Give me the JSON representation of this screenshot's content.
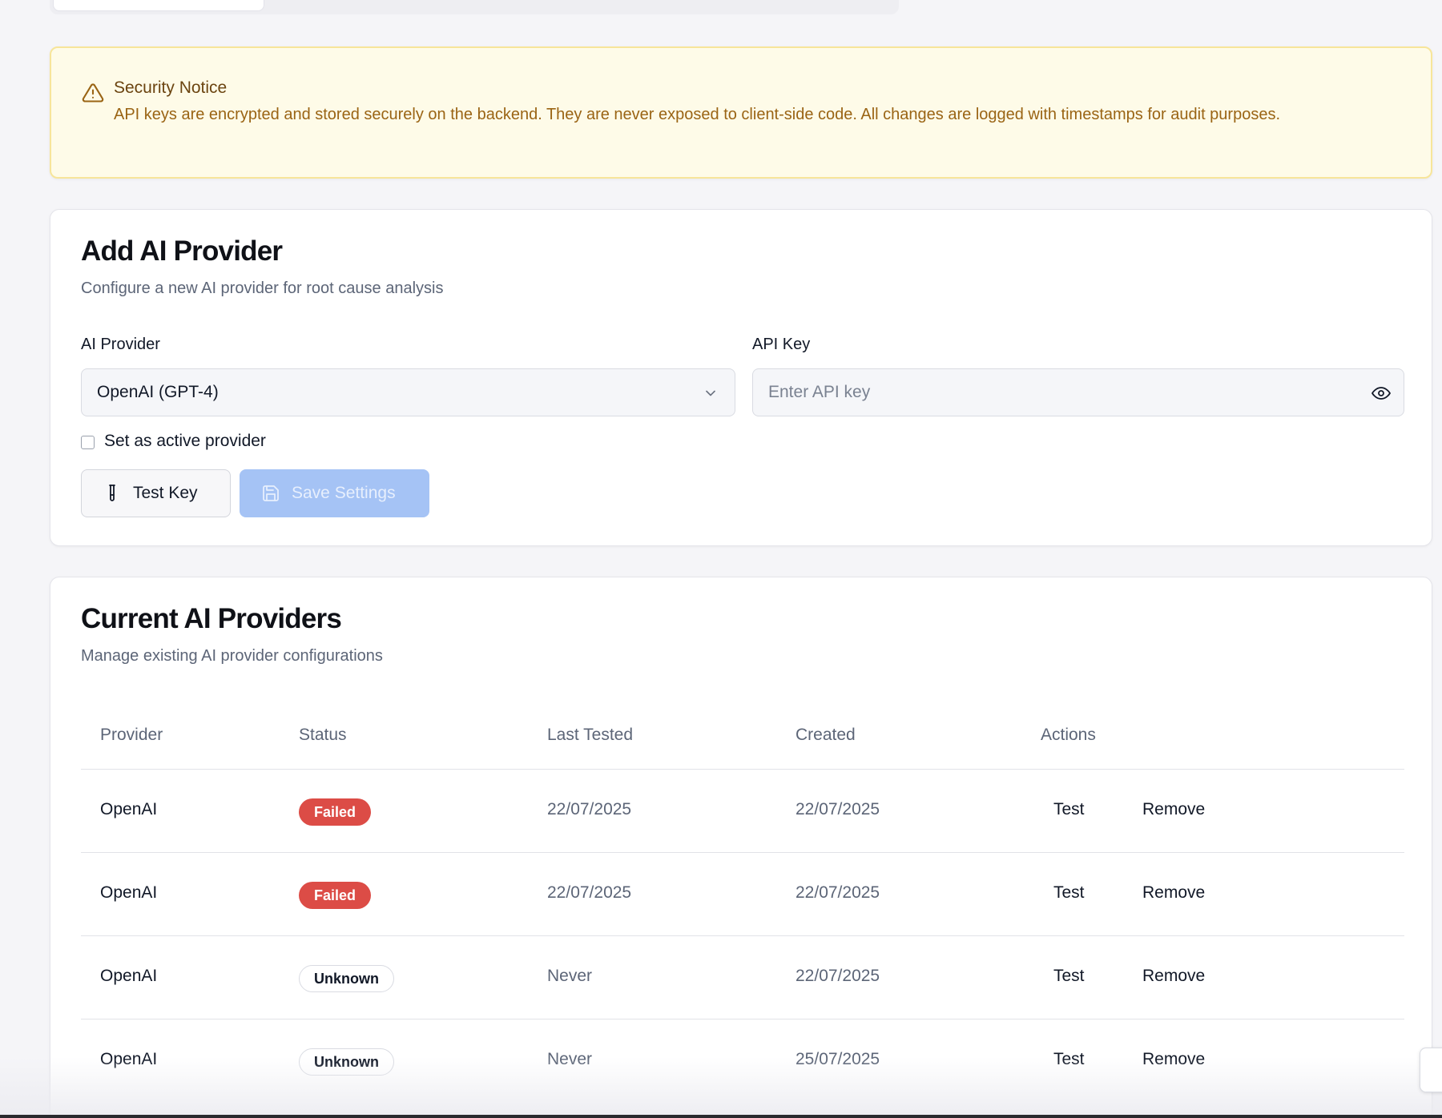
{
  "notice": {
    "title": "Security Notice",
    "body": "API keys are encrypted and stored securely on the backend. They are never exposed to client-side code. All changes are logged with timestamps for audit purposes.",
    "icon": "warning-triangle-icon"
  },
  "add_provider": {
    "title": "Add AI Provider",
    "subtitle": "Configure a new AI provider for root cause analysis",
    "provider_label": "AI Provider",
    "provider_value": "OpenAI (GPT-4)",
    "api_key_label": "API Key",
    "api_key_placeholder": "Enter API key",
    "active_checkbox_label": "Set as active provider",
    "active_checked": false,
    "test_button": "Test Key",
    "save_button": "Save Settings"
  },
  "providers": {
    "title": "Current AI Providers",
    "subtitle": "Manage existing AI provider configurations",
    "columns": [
      "Provider",
      "Status",
      "Last Tested",
      "Created",
      "Actions"
    ],
    "rows": [
      {
        "provider": "OpenAI",
        "status": "Failed",
        "last_tested": "22/07/2025",
        "created": "22/07/2025",
        "test": "Test",
        "remove": "Remove"
      },
      {
        "provider": "OpenAI",
        "status": "Failed",
        "last_tested": "22/07/2025",
        "created": "22/07/2025",
        "test": "Test",
        "remove": "Remove"
      },
      {
        "provider": "OpenAI",
        "status": "Unknown",
        "last_tested": "Never",
        "created": "22/07/2025",
        "test": "Test",
        "remove": "Remove"
      },
      {
        "provider": "OpenAI",
        "status": "Unknown",
        "last_tested": "Never",
        "created": "25/07/2025",
        "test": "Test",
        "remove": "Remove"
      }
    ]
  },
  "colors": {
    "failed": "#dc4c46",
    "save_disabled": "#a5c3f5",
    "notice_bg": "#fefbe8",
    "notice_border": "#f7e59a"
  }
}
